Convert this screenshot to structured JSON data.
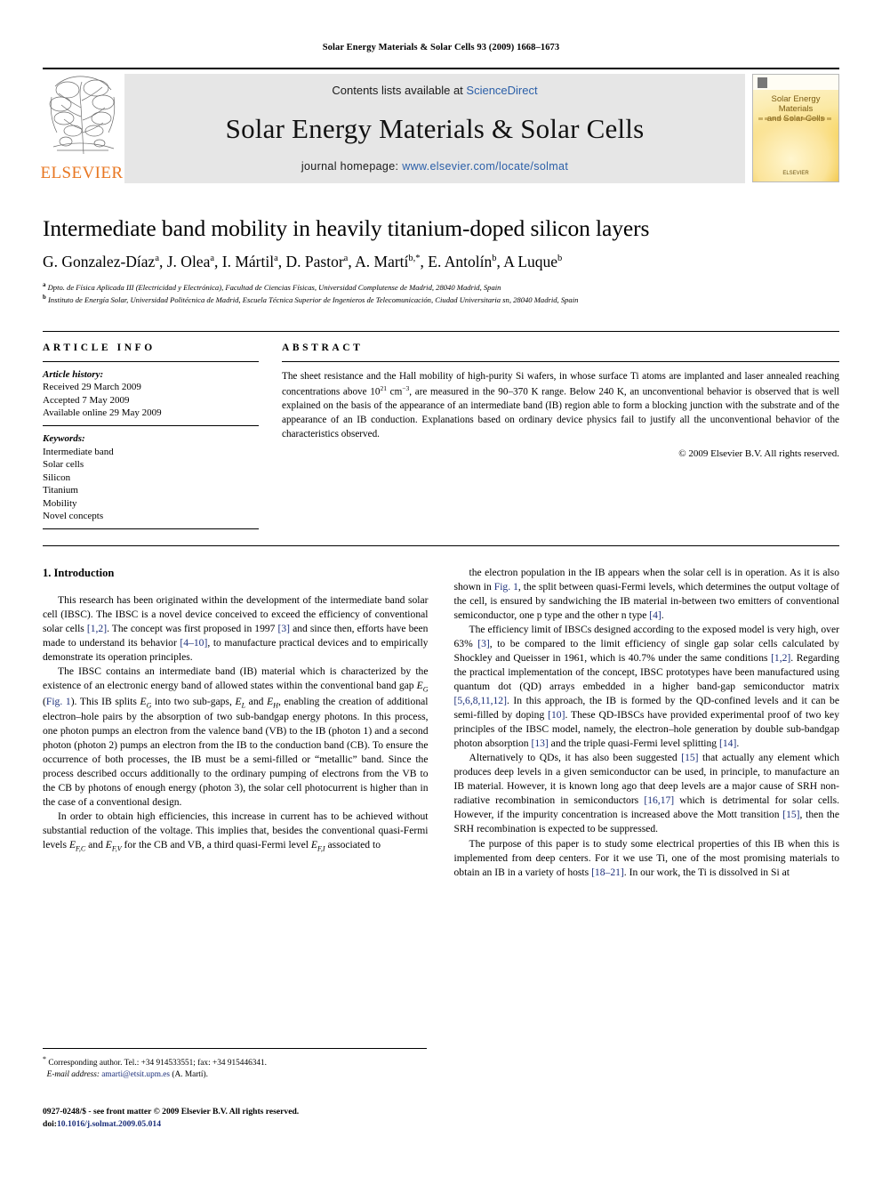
{
  "running_head": "Solar Energy Materials & Solar Cells 93 (2009) 1668–1673",
  "masthead": {
    "publisher": "ELSEVIER",
    "contents_prefix": "Contents lists available at ",
    "contents_link": "ScienceDirect",
    "journal_title": "Solar Energy Materials & Solar Cells",
    "homepage_prefix": "journal homepage: ",
    "homepage_url": "www.elsevier.com/locate/solmat",
    "cover_title_line1": "Solar Energy Materials",
    "cover_title_line2": "and Solar Cells",
    "cover_footer": "ELSEVIER"
  },
  "article": {
    "title": "Intermediate band mobility in heavily titanium-doped silicon layers",
    "authors_html": "G. Gonzalez-Díaz<sup>a</sup>, J. Olea<sup>a</sup>, I. Mártil<sup>a</sup>, D. Pastor<sup>a</sup>, A. Martí<sup>b,*</sup>, E. Antolín<sup>b</sup>, A Luque<sup>b</sup>",
    "affiliation_a": "Dpto. de Física Aplicada III (Electricidad y Electrónica), Facultad de Ciencias Físicas, Universidad Complutense de Madrid, 28040 Madrid, Spain",
    "affiliation_b": "Instituto de Energía Solar, Universidad Politécnica de Madrid, Escuela Técnica Superior de Ingenieros de Telecomunicación, Ciudad Universitaria sn, 28040 Madrid, Spain"
  },
  "article_info": {
    "heading": "ARTICLE INFO",
    "history_label": "Article history:",
    "received": "Received 29 March 2009",
    "accepted": "Accepted 7 May 2009",
    "available": "Available online 29 May 2009",
    "keywords_label": "Keywords:",
    "keywords": [
      "Intermediate band",
      "Solar cells",
      "Silicon",
      "Titanium",
      "Mobility",
      "Novel concepts"
    ]
  },
  "abstract": {
    "heading": "ABSTRACT",
    "text_html": "The sheet resistance and the Hall mobility of high-purity Si wafers, in whose surface Ti atoms are implanted and laser annealed reaching concentrations above 10<sup>21</sup> cm<sup>−3</sup>, are measured in the 90–370 K range. Below 240 K, an unconventional behavior is observed that is well explained on the basis of the appearance of an intermediate band (IB) region able to form a blocking junction with the substrate and of the appearance of an IB conduction. Explanations based on ordinary device physics fail to justify all the unconventional behavior of the characteristics observed.",
    "copyright": "© 2009 Elsevier B.V. All rights reserved."
  },
  "body": {
    "section_heading": "1. Introduction",
    "left_paragraphs_html": [
      "This research has been originated within the development of the intermediate band solar cell (IBSC). The IBSC is a novel device conceived to exceed the efficiency of conventional solar cells <span class=\"ref\">[1,2]</span>. The concept was first proposed in 1997 <span class=\"ref\">[3]</span> and since then, efforts have been made to understand its behavior <span class=\"ref\">[4–10]</span>, to manufacture practical devices and to empirically demonstrate its operation principles.",
      "The IBSC contains an intermediate band (IB) material which is characterized by the existence of an electronic energy band of allowed states within the conventional band gap <span class=\"it\">E<sub>G</sub></span> (<span class=\"ref\">Fig. 1</span>). This IB splits <span class=\"it\">E<sub>G</sub></span> into two sub-gaps, <span class=\"it\">E<sub>L</sub></span> and <span class=\"it\">E<sub>H</sub></span>, enabling the creation of additional electron–hole pairs by the absorption of two sub-bandgap energy photons. In this process, one photon pumps an electron from the valence band (VB) to the IB (photon 1) and a second photon (photon 2) pumps an electron from the IB to the conduction band (CB). To ensure the occurrence of both processes, the IB must be a semi-filled or “metallic” band. Since the process described occurs additionally to the ordinary pumping of electrons from the VB to the CB by photons of enough energy (photon 3), the solar cell photocurrent is higher than in the case of a conventional design.",
      "In order to obtain high efficiencies, this increase in current has to be achieved without substantial reduction of the voltage. This implies that, besides the conventional quasi-Fermi levels <span class=\"it\">E<sub>F,C</sub></span> and <span class=\"it\">E<sub>F,V</sub></span> for the CB and VB, a third quasi-Fermi level <span class=\"it\">E<sub>F,I</sub></span> associated to"
    ],
    "right_paragraphs_html": [
      "the electron population in the IB appears when the solar cell is in operation. As it is also shown in <span class=\"ref\">Fig. 1</span>, the split between quasi-Fermi levels, which determines the output voltage of the cell, is ensured by sandwiching the IB material in-between two emitters of conventional semiconductor, one p type and the other n type <span class=\"ref\">[4]</span>.",
      "The efficiency limit of IBSCs designed according to the exposed model is very high, over 63% <span class=\"ref\">[3]</span>, to be compared to the limit efficiency of single gap solar cells calculated by Shockley and Queisser in 1961, which is 40.7% under the same conditions <span class=\"ref\">[1,2]</span>. Regarding the practical implementation of the concept, IBSC prototypes have been manufactured using quantum dot (QD) arrays embedded in a higher band-gap semiconductor matrix <span class=\"ref\">[5,6,8,11,12]</span>. In this approach, the IB is formed by the QD-confined levels and it can be semi-filled by doping <span class=\"ref\">[10]</span>. These QD-IBSCs have provided experimental proof of two key principles of the IBSC model, namely, the electron–hole generation by double sub-bandgap photon absorption <span class=\"ref\">[13]</span> and the triple quasi-Fermi level splitting <span class=\"ref\">[14]</span>.",
      "Alternatively to QDs, it has also been suggested <span class=\"ref\">[15]</span> that actually any element which produces deep levels in a given semiconductor can be used, in principle, to manufacture an IB material. However, it is known long ago that deep levels are a major cause of SRH non-radiative recombination in semiconductors <span class=\"ref\">[16,17]</span> which is detrimental for solar cells. However, if the impurity concentration is increased above the Mott transition <span class=\"ref\">[15]</span>, then the SRH recombination is expected to be suppressed.",
      "The purpose of this paper is to study some electrical properties of this IB when this is implemented from deep centers. For it we use Ti, one of the most promising materials to obtain an IB in a variety of hosts <span class=\"ref\">[18–21]</span>. In our work, the Ti is dissolved in Si at"
    ]
  },
  "footnote": {
    "corresponding_html": "<sup>*</sup> Corresponding author. Tel.: +34 914533551; fax: +34 915446341.",
    "email_label": "E-mail address:",
    "email": "amarti@etsit.upm.es",
    "email_owner": "(A. Martí)."
  },
  "footer": {
    "issn_line": "0927-0248/$ - see front matter © 2009 Elsevier B.V. All rights reserved.",
    "doi_label": "doi:",
    "doi": "10.1016/j.solmat.2009.05.014"
  }
}
